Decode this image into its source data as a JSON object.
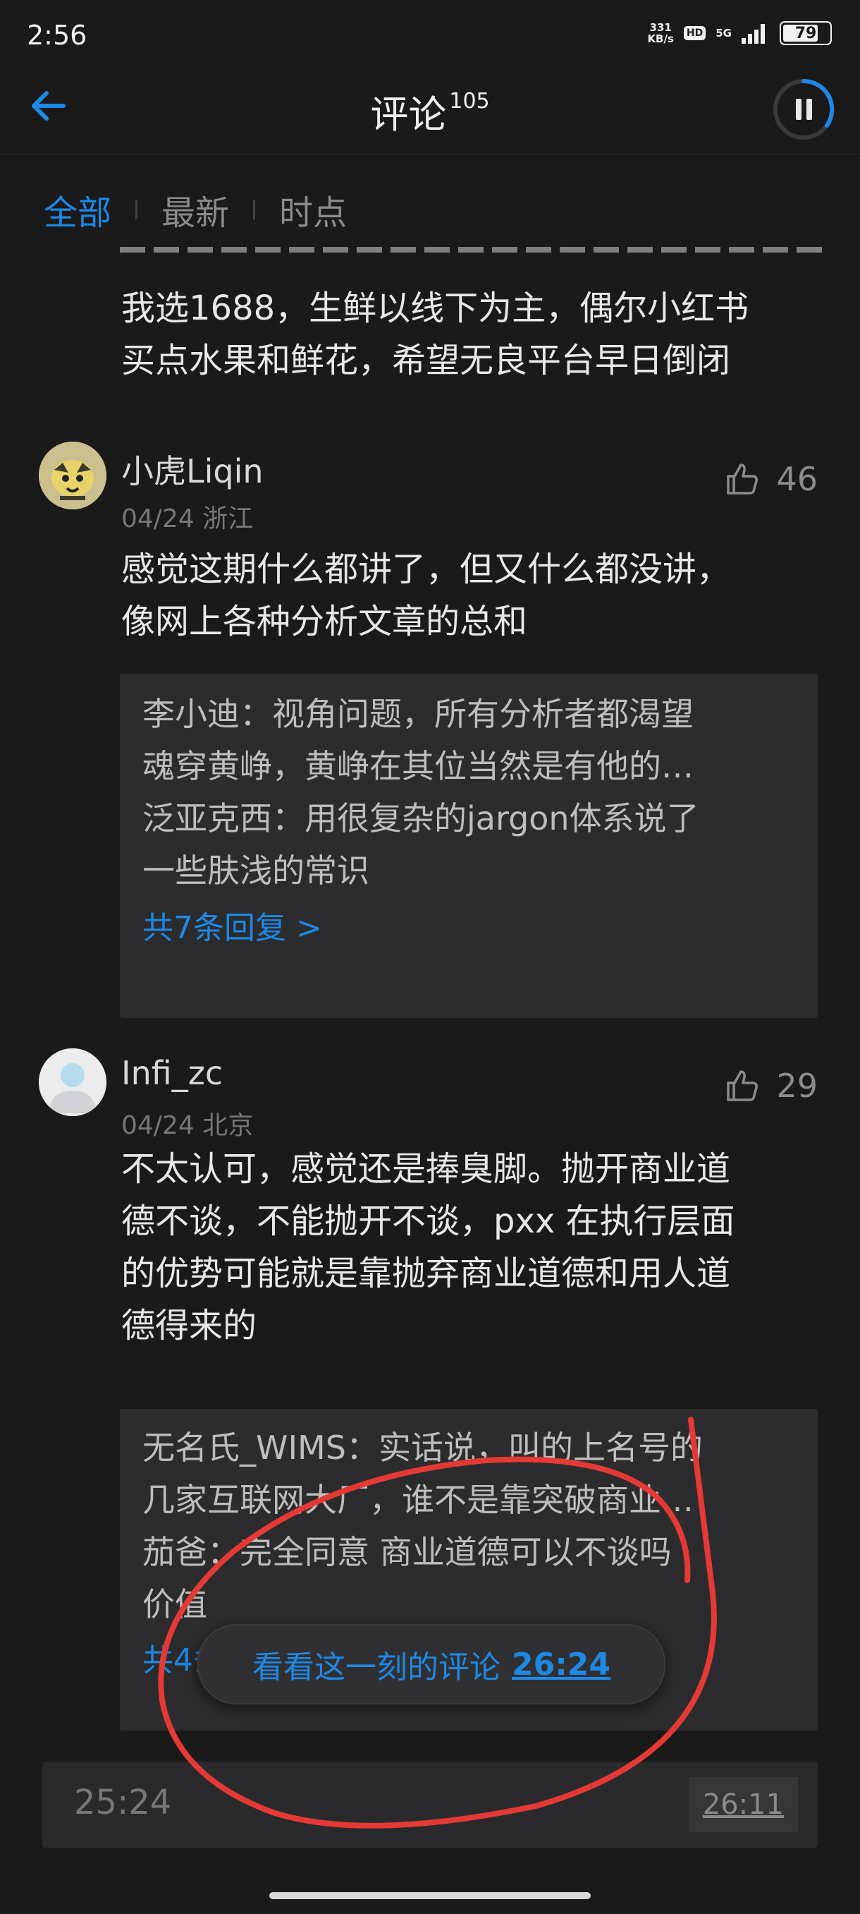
{
  "status_bar": {
    "time": "2:56",
    "speed_value": "331",
    "speed_unit": "KB/s",
    "hd": "HD",
    "network": "5G",
    "battery": "79"
  },
  "header": {
    "title": "评论",
    "count": "105"
  },
  "tabs": [
    {
      "label": "全部",
      "active": true
    },
    {
      "label": "最新",
      "active": false
    },
    {
      "label": "时点",
      "active": false
    }
  ],
  "partial_comment": {
    "lines": [
      "我选1688，生鲜以线下为主，偶尔小红书",
      "买点水果和鲜花，希望无良平台早日倒闭"
    ]
  },
  "comments": [
    {
      "username": "小虎Liqin",
      "date": "04/24",
      "location": "浙江",
      "likes": "46",
      "lines": [
        "感觉这期什么都讲了，但又什么都没讲，",
        "像网上各种分析文章的总和"
      ],
      "replies": [
        "李小迪：视角问题，所有分析者都渴望",
        "魂穿黄峥，黄峥在其位当然是有他的…",
        "泛亚克西：用很复杂的jargon体系说了",
        "一些肤浅的常识"
      ],
      "more_replies": "共7条回复 >"
    },
    {
      "username": "Infi_zc",
      "date": "04/24",
      "location": "北京",
      "likes": "29",
      "lines": [
        "不太认可，感觉还是捧臭脚。抛开商业道",
        "德不谈，不能抛开不谈，pxx 在执行层面",
        "的优势可能就是靠抛弃商业道德和用人道",
        "德得来的"
      ],
      "replies": [
        "无名氏_WIMS：实话说，叫的上名号的",
        "几家互联网大厂，谁不是靠突破商业…",
        "茄爸：完全同意 商业道德可以不谈吗",
        "价值"
      ],
      "more_replies": "共4条回复 >"
    }
  ],
  "floating_pill": {
    "label": "看看这一刻的评论",
    "time": "26:24"
  },
  "input_bar": {
    "time": "25:24",
    "tag": "26:11"
  },
  "colors": {
    "accent": "#1e88e5",
    "background": "#1a1a1b",
    "annotation": "#e53935"
  }
}
